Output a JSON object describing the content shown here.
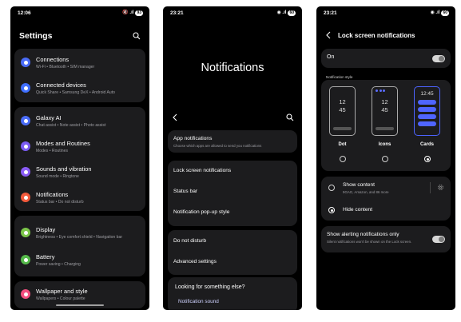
{
  "phone1": {
    "status": {
      "time": "12:06",
      "icons": "🔇 .ıl",
      "battery": "93"
    },
    "title": "Settings",
    "groups": [
      [
        {
          "title": "Connections",
          "subtitle": "Wi-Fi  •  Bluetooth  •  SIM manager",
          "color": "#4a6cf7",
          "icon": "wifi-icon"
        },
        {
          "title": "Connected devices",
          "subtitle": "Quick Share  •  Samsung DeX  •  Android Auto",
          "color": "#3f6fff",
          "icon": "devices-icon"
        }
      ],
      [
        {
          "title": "Galaxy AI",
          "subtitle": "Chat assist  •  Note assist  •  Photo assist",
          "color": "#4a6cf7",
          "icon": "ai-icon"
        },
        {
          "title": "Modes and Routines",
          "subtitle": "Modes  •  Routines",
          "color": "#7b5cf5",
          "icon": "modes-icon"
        },
        {
          "title": "Sounds and vibration",
          "subtitle": "Sound mode  •  Ringtone",
          "color": "#8a5cf5",
          "icon": "sound-icon"
        },
        {
          "title": "Notifications",
          "subtitle": "Status bar  •  Do not disturb",
          "color": "#f25a3c",
          "icon": "bell-icon"
        }
      ],
      [
        {
          "title": "Display",
          "subtitle": "Brightness  •  Eye comfort shield  •  Navigation bar",
          "color": "#7cc64a",
          "icon": "display-icon"
        },
        {
          "title": "Battery",
          "subtitle": "Power saving  •  Charging",
          "color": "#55b94a",
          "icon": "battery-icon"
        }
      ],
      [
        {
          "title": "Wallpaper and style",
          "subtitle": "Wallpapers  •  Colour palette",
          "color": "#f24f7f",
          "icon": "wallpaper-icon"
        }
      ]
    ]
  },
  "phone2": {
    "status": {
      "time": "23:21",
      "icons": "◉ .ıl",
      "battery": "60"
    },
    "header": "Notifications",
    "app_notifications": {
      "title": "App notifications",
      "subtitle": "Choose which apps are allowed to send you notifications"
    },
    "group2": [
      "Lock screen notifications",
      "Status bar",
      "Notification pop-up style"
    ],
    "group3": [
      "Do not disturb",
      "Advanced settings"
    ],
    "looking": {
      "title": "Looking for something else?",
      "link": "Notification sound"
    }
  },
  "phone3": {
    "status": {
      "time": "23:21",
      "icons": "◉ .ıl",
      "battery": "60"
    },
    "title": "Lock screen notifications",
    "on_label": "On",
    "style_label": "Notification style",
    "styles": [
      {
        "name": "Dot",
        "clock": [
          "12",
          "45"
        ]
      },
      {
        "name": "Icons",
        "clock": [
          "12",
          "45"
        ]
      },
      {
        "name": "Cards",
        "clock": [
          "12:45"
        ]
      }
    ],
    "selected_style": "Cards",
    "show_content": {
      "title": "Show content",
      "subtitle": "9GAG, Amazon, and 86 more"
    },
    "hide_content": "Hide content",
    "alerting": {
      "title": "Show alerting notifications only",
      "subtitle": "Silent notifications won't be shown on the Lock screen."
    },
    "accent": "#4f65ff"
  }
}
